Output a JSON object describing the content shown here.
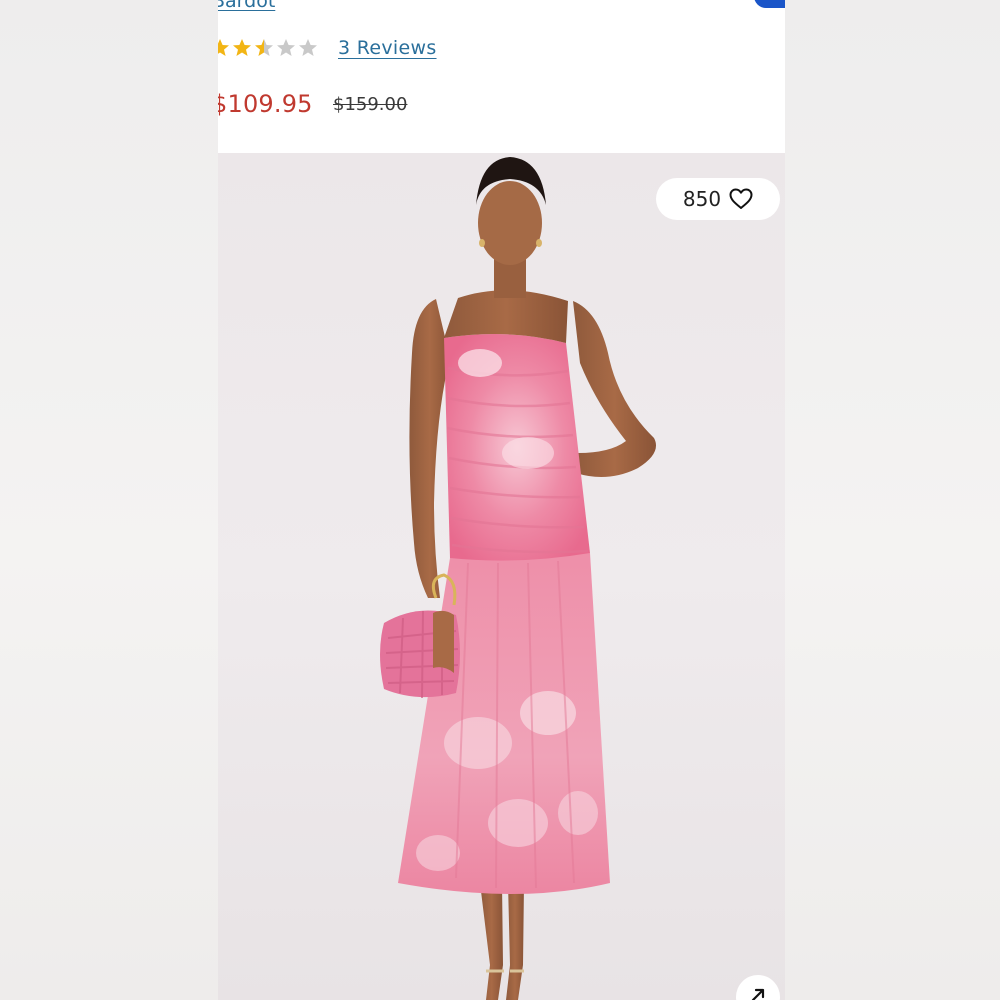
{
  "product": {
    "brand_link": "Bardot",
    "rating": 2.5,
    "max_rating": 5,
    "reviews_link": "3 Reviews",
    "sale_price": "$109.95",
    "original_price": "$159.00"
  },
  "gallery": {
    "like_count": "850",
    "icons": {
      "like": "heart-outline-icon",
      "expand": "arrow-up-right-icon"
    }
  },
  "colors": {
    "link": "#2a6f9b",
    "sale_price": "#c0392f",
    "star_filled": "#f2b515",
    "star_empty": "#c9c9c9",
    "accent_button": "#1a55c8",
    "dress_pink": "#ee7f9d"
  }
}
